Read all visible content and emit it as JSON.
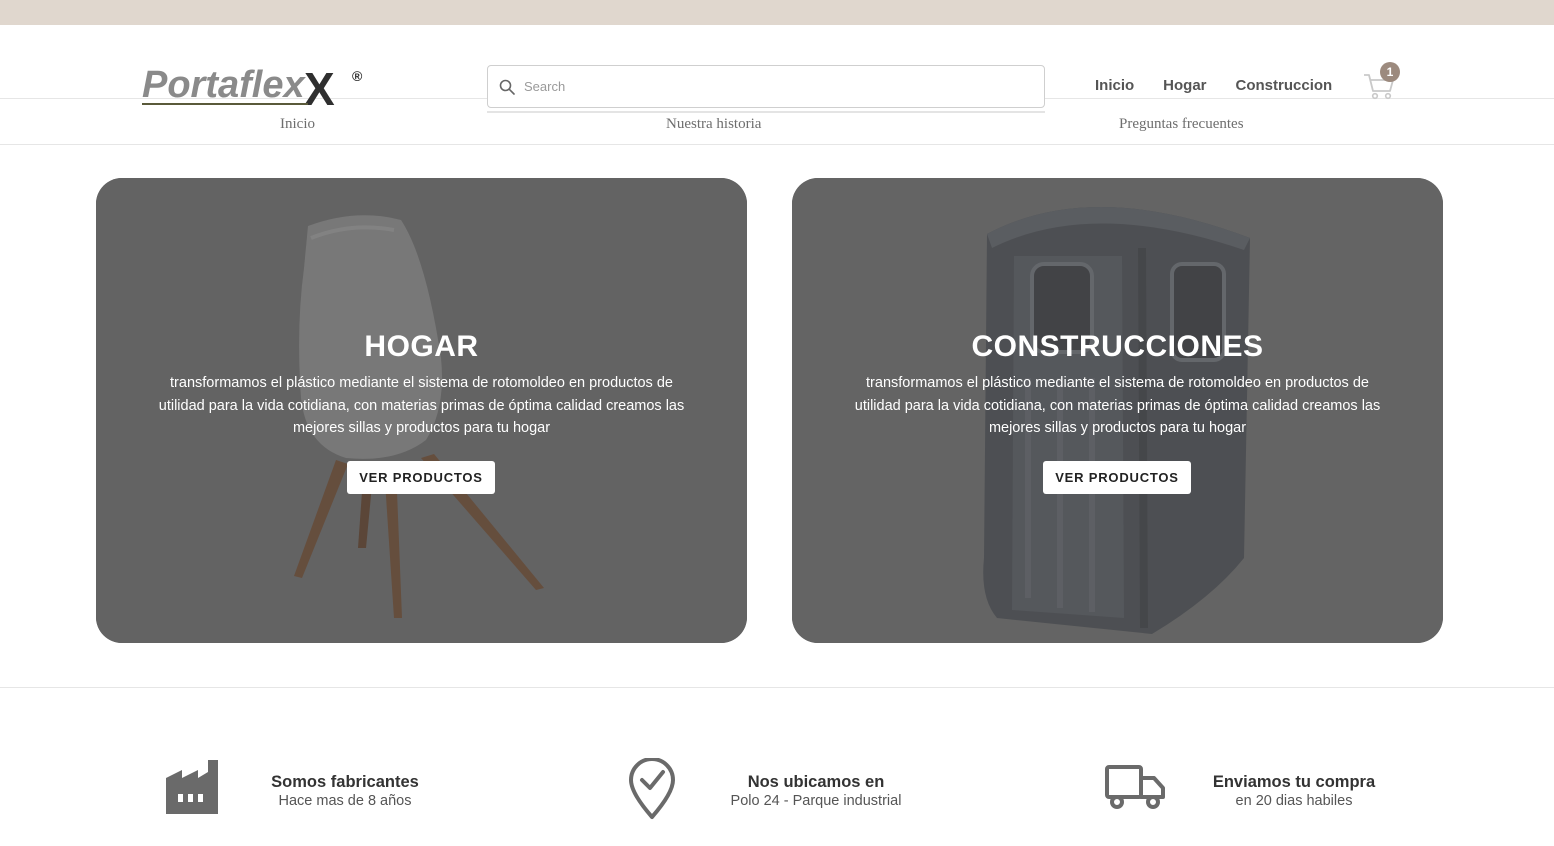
{
  "brand": {
    "logo_text": "Portaflex",
    "logo_mark": "X",
    "registered": "®"
  },
  "search": {
    "placeholder": "Search"
  },
  "header_nav": [
    "Inicio",
    "Hogar",
    "Construccion"
  ],
  "cart": {
    "count": "1"
  },
  "sub_nav": [
    "Inicio",
    "Nuestra historia",
    "Preguntas frecuentes"
  ],
  "cards": [
    {
      "title": "HOGAR",
      "description": "transformamos el plástico mediante el sistema de rotomoldeo en productos de utilidad para la vida cotidiana, con materias primas de óptima calidad creamos las mejores sillas y productos para tu hogar",
      "button": "VER PRODUCTOS"
    },
    {
      "title": "CONSTRUCCIONES",
      "description": "transformamos el plástico mediante el sistema de rotomoldeo en productos de utilidad para la vida cotidiana, con materias primas de óptima calidad creamos las mejores sillas y productos para tu hogar",
      "button": "VER PRODUCTOS"
    }
  ],
  "features": [
    {
      "icon": "factory-icon",
      "title": "Somos fabricantes",
      "subtitle": "Hace mas de 8 años"
    },
    {
      "icon": "location-check-icon",
      "title": "Nos ubicamos en",
      "subtitle": "Polo 24 - Parque industrial"
    },
    {
      "icon": "truck-icon",
      "title": "Enviamos tu compra",
      "subtitle": "en 20 dias habiles"
    }
  ],
  "colors": {
    "top_strip": "#e0d7ce",
    "logo_gray": "#8a8a8a",
    "logo_dark": "#2f2f2f",
    "logo_accent": "#5a5a3a",
    "card_overlay": "#6a6a6a",
    "badge": "#9c8a7e"
  }
}
